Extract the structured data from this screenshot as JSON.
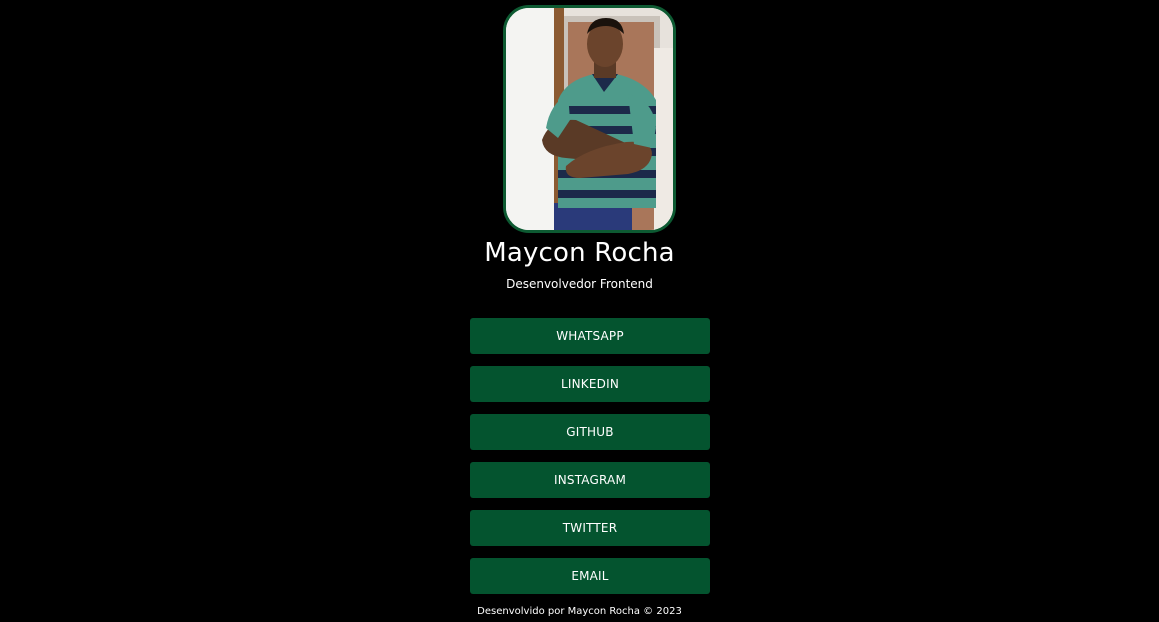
{
  "profile": {
    "name": "Maycon Rocha",
    "role": "Desenvolvedor Frontend"
  },
  "links": [
    {
      "label": "WHATSAPP",
      "icon": "whatsapp"
    },
    {
      "label": "LINKEDIN",
      "icon": "linkedin"
    },
    {
      "label": "GITHUB",
      "icon": "github"
    },
    {
      "label": "INSTAGRAM",
      "icon": "instagram"
    },
    {
      "label": "TWITTER",
      "icon": "twitter"
    },
    {
      "label": "EMAIL",
      "icon": "email"
    }
  ],
  "footer": {
    "text": "Desenvolvido por Maycon Rocha © 2023"
  },
  "colors": {
    "background": "#000000",
    "button": "#04542f",
    "avatar_border": "#0d5a32",
    "text": "#ffffff"
  }
}
